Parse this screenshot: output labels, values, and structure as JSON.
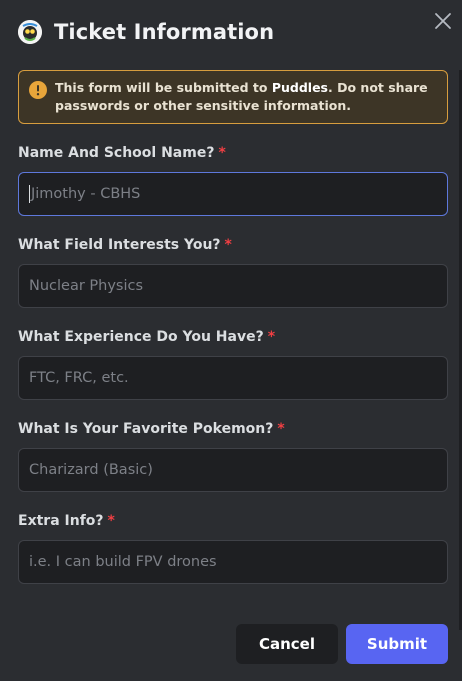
{
  "modal": {
    "title": "Ticket Information",
    "icon": "avatar-icon"
  },
  "notice": {
    "prefix": "This form will be submitted to ",
    "app_name": "Puddles",
    "suffix": ". Do not share passwords or other sensitive information.",
    "icon": "warning-icon",
    "accent_color": "#d79d3e"
  },
  "fields": [
    {
      "label": "Name And School Name?",
      "required": "*",
      "placeholder": "Jimothy - CBHS"
    },
    {
      "label": "What Field Interests You?",
      "required": "*",
      "placeholder": "Nuclear Physics"
    },
    {
      "label": "What Experience Do You Have?",
      "required": "*",
      "placeholder": "FTC, FRC, etc."
    },
    {
      "label": "What Is Your Favorite Pokemon?",
      "required": "*",
      "placeholder": "Charizard (Basic)"
    },
    {
      "label": "Extra Info?",
      "required": "*",
      "placeholder": "i.e. I can build FPV drones"
    }
  ],
  "buttons": {
    "cancel": "Cancel",
    "submit": "Submit"
  },
  "colors": {
    "background": "#2b2d31",
    "input": "#1e1f22",
    "primary": "#5865f2",
    "required": "#f23f43",
    "focus": "#5e78dc"
  }
}
